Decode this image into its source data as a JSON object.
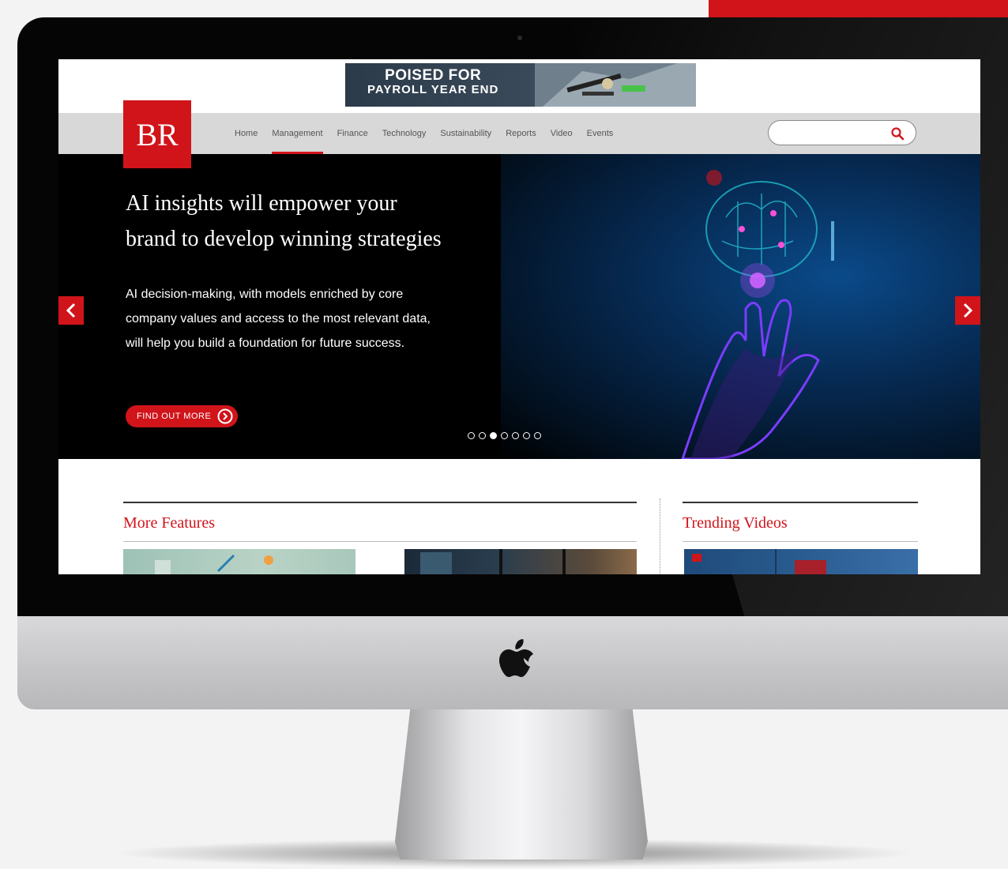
{
  "ad": {
    "line1": "POISED FOR",
    "line2": "PAYROLL YEAR END"
  },
  "brand": {
    "logo_text": "BR",
    "accent": "#d0141a"
  },
  "nav": {
    "items": [
      "Home",
      "Management",
      "Finance",
      "Technology",
      "Sustainability",
      "Reports",
      "Video",
      "Events"
    ],
    "active_index": 1
  },
  "search": {
    "placeholder": ""
  },
  "hero": {
    "title_line1": "AI insights will empower your",
    "title_line2": "brand to develop winning strategies",
    "body": "AI decision-making, with models enriched by core company values and access to the most relevant data, will help you build a foundation for future success.",
    "cta_label": "FIND OUT MORE",
    "dot_count": 7,
    "active_dot": 2
  },
  "sections": {
    "features_title": "More Features",
    "videos_title": "Trending Videos"
  }
}
